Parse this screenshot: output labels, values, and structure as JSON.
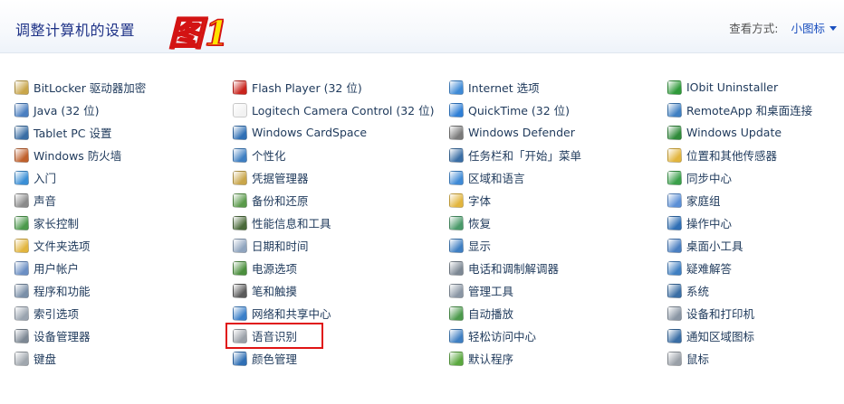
{
  "header": {
    "title": "调整计算机的设置",
    "stamp": "图1",
    "view_by_label": "查看方式:",
    "view_by_value": "小图标"
  },
  "columns": [
    [
      {
        "label": "BitLocker 驱动器加密",
        "icon": "bitlocker-key-icon",
        "color": "#c9a64a"
      },
      {
        "label": "Java (32 位)",
        "icon": "java-icon",
        "color": "#4a7fc1"
      },
      {
        "label": "Tablet PC 设置",
        "icon": "tablet-pc-icon",
        "color": "#3a6ea5"
      },
      {
        "label": "Windows 防火墙",
        "icon": "firewall-icon",
        "color": "#c0602c"
      },
      {
        "label": "入门",
        "icon": "getting-started-icon",
        "color": "#3a8fd6"
      },
      {
        "label": "声音",
        "icon": "speaker-icon",
        "color": "#8a8a8a"
      },
      {
        "label": "家长控制",
        "icon": "parental-controls-icon",
        "color": "#4c9a4c"
      },
      {
        "label": "文件夹选项",
        "icon": "folder-options-icon",
        "color": "#e2b53d"
      },
      {
        "label": "用户帐户",
        "icon": "user-accounts-icon",
        "color": "#6b8fc4"
      },
      {
        "label": "程序和功能",
        "icon": "programs-features-icon",
        "color": "#7a8fa8"
      },
      {
        "label": "索引选项",
        "icon": "indexing-icon",
        "color": "#9aa4b0"
      },
      {
        "label": "设备管理器",
        "icon": "device-manager-icon",
        "color": "#7d8894"
      },
      {
        "label": "键盘",
        "icon": "keyboard-icon",
        "color": "#a0a7ae"
      }
    ],
    [
      {
        "label": "Flash Player (32 位)",
        "icon": "flash-icon",
        "color": "#c9231c"
      },
      {
        "label": "Logitech Camera Control (32 位)",
        "icon": "document-icon",
        "color": "#f2f2f2"
      },
      {
        "label": "Windows CardSpace",
        "icon": "cardspace-icon",
        "color": "#2f6fb5"
      },
      {
        "label": "个性化",
        "icon": "personalization-icon",
        "color": "#3f7fc2"
      },
      {
        "label": "凭据管理器",
        "icon": "credential-manager-icon",
        "color": "#c9a64a"
      },
      {
        "label": "备份和还原",
        "icon": "backup-icon",
        "color": "#5a9a4a"
      },
      {
        "label": "性能信息和工具",
        "icon": "performance-icon",
        "color": "#4a6a3a"
      },
      {
        "label": "日期和时间",
        "icon": "clock-icon",
        "color": "#8fa4be"
      },
      {
        "label": "电源选项",
        "icon": "power-options-icon",
        "color": "#4b8f3d"
      },
      {
        "label": "笔和触摸",
        "icon": "pen-icon",
        "color": "#5a5a5a"
      },
      {
        "label": "网络和共享中心",
        "icon": "network-icon",
        "color": "#3a7fc9"
      },
      {
        "label": "语音识别",
        "icon": "microphone-icon",
        "color": "#9aa0a8",
        "highlight": true
      },
      {
        "label": "颜色管理",
        "icon": "color-management-icon",
        "color": "#2f6fb5"
      }
    ],
    [
      {
        "label": "Internet 选项",
        "icon": "internet-options-icon",
        "color": "#3f8ad6"
      },
      {
        "label": "QuickTime (32 位)",
        "icon": "quicktime-icon",
        "color": "#2f7fd6"
      },
      {
        "label": "Windows Defender",
        "icon": "defender-icon",
        "color": "#7a7a7a"
      },
      {
        "label": "任务栏和「开始」菜单",
        "icon": "taskbar-icon",
        "color": "#3a6ea5"
      },
      {
        "label": "区域和语言",
        "icon": "region-language-icon",
        "color": "#3f8ad6"
      },
      {
        "label": "字体",
        "icon": "fonts-icon",
        "color": "#e2b53d"
      },
      {
        "label": "恢复",
        "icon": "recovery-icon",
        "color": "#4a9a6a"
      },
      {
        "label": "显示",
        "icon": "display-icon",
        "color": "#3f7fc2"
      },
      {
        "label": "电话和调制解调器",
        "icon": "phone-modem-icon",
        "color": "#7d8894"
      },
      {
        "label": "管理工具",
        "icon": "admin-tools-icon",
        "color": "#8a96a4"
      },
      {
        "label": "自动播放",
        "icon": "autoplay-icon",
        "color": "#4c9a4c"
      },
      {
        "label": "轻松访问中心",
        "icon": "ease-of-access-icon",
        "color": "#3f7fc2"
      },
      {
        "label": "默认程序",
        "icon": "default-programs-icon",
        "color": "#5aa83e"
      }
    ],
    [
      {
        "label": "IObit Uninstaller",
        "icon": "iobit-icon",
        "color": "#2f9a3a"
      },
      {
        "label": "RemoteApp 和桌面连接",
        "icon": "remoteapp-icon",
        "color": "#3f7fc2"
      },
      {
        "label": "Windows Update",
        "icon": "windows-update-icon",
        "color": "#2f8a3a"
      },
      {
        "label": "位置和其他传感器",
        "icon": "location-sensors-icon",
        "color": "#e2b53d"
      },
      {
        "label": "同步中心",
        "icon": "sync-center-icon",
        "color": "#3aa04a"
      },
      {
        "label": "家庭组",
        "icon": "homegroup-icon",
        "color": "#5b8fd6"
      },
      {
        "label": "操作中心",
        "icon": "action-center-flag-icon",
        "color": "#2f6fb5"
      },
      {
        "label": "桌面小工具",
        "icon": "gadgets-icon",
        "color": "#4a7fc1"
      },
      {
        "label": "疑难解答",
        "icon": "troubleshooting-icon",
        "color": "#3f7fc2"
      },
      {
        "label": "系统",
        "icon": "system-icon",
        "color": "#3a6ea5"
      },
      {
        "label": "设备和打印机",
        "icon": "printer-icon",
        "color": "#8a96a4"
      },
      {
        "label": "通知区域图标",
        "icon": "notification-icons-icon",
        "color": "#3a6ea5"
      },
      {
        "label": "鼠标",
        "icon": "mouse-icon",
        "color": "#9aa0a8"
      }
    ]
  ]
}
